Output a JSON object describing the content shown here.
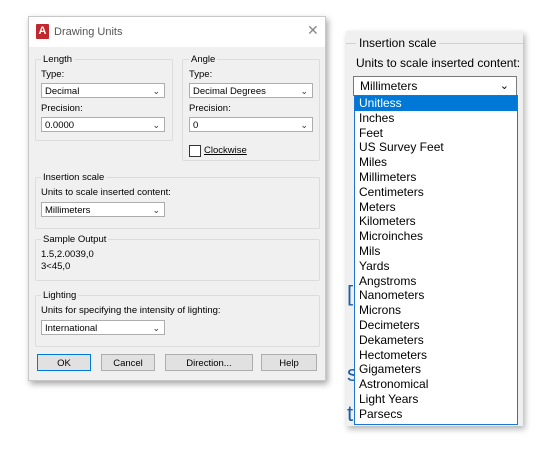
{
  "dialog": {
    "title": "Drawing Units",
    "length": {
      "group_label": "Length",
      "type_label": "Type:",
      "type_value": "Decimal",
      "precision_label": "Precision:",
      "precision_value": "0.0000"
    },
    "angle": {
      "group_label": "Angle",
      "type_label": "Type:",
      "type_value": "Decimal Degrees",
      "precision_label": "Precision:",
      "precision_value": "0",
      "clockwise_label": "Clockwise"
    },
    "insertion": {
      "group_label": "Insertion scale",
      "prompt": "Units to scale inserted content:",
      "value": "Millimeters"
    },
    "sample": {
      "group_label": "Sample Output",
      "line1": "1.5,2.0039,0",
      "line2": "3<45,0"
    },
    "lighting": {
      "group_label": "Lighting",
      "prompt": "Units for specifying the intensity of lighting:",
      "value": "International"
    },
    "buttons": {
      "ok": "OK",
      "cancel": "Cancel",
      "direction": "Direction...",
      "help": "Help"
    }
  },
  "panel": {
    "group_label": "Insertion scale",
    "prompt": "Units to scale inserted content:",
    "value": "Millimeters",
    "options": [
      "Unitless",
      "Inches",
      "Feet",
      "US Survey Feet",
      "Miles",
      "Millimeters",
      "Centimeters",
      "Meters",
      "Kilometers",
      "Microinches",
      "Mils",
      "Yards",
      "Angstroms",
      "Nanometers",
      "Microns",
      "Decimeters",
      "Dekameters",
      "Hectometers",
      "Gigameters",
      "Astronomical",
      "Light Years",
      "Parsecs"
    ],
    "selected_index": 0
  },
  "colors": {
    "selection": "#0078d7",
    "dialog_bg": "#f0f0f0",
    "icon_red": "#c1272d"
  }
}
